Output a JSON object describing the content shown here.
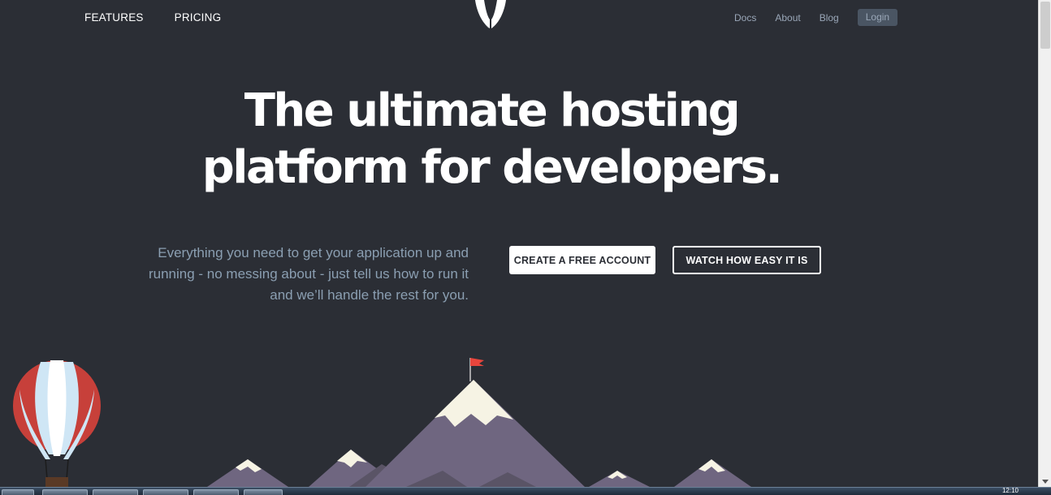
{
  "nav": {
    "left_items": [
      "FEATURES",
      "PRICING"
    ],
    "right_links": [
      "Docs",
      "About",
      "Blog"
    ],
    "login_label": "Login"
  },
  "hero": {
    "title_line1": "The ultimate hosting",
    "title_line2": "platform for developers.",
    "tagline": "Everything you need to get your application up and running - no messing about - just tell us how to run it and we’ll handle the rest for you.",
    "create_label": "CREATE A FREE ACCOUNT",
    "watch_label": "WATCH HOW EASY IT IS"
  },
  "colors": {
    "background": "#2b2e35",
    "tagline": "#8b9fb2",
    "mountain": "#6f6680",
    "snow": "#f6f3e4",
    "flag": "#e8453c",
    "balloon_red": "#c7403a",
    "balloon_blue": "#cfe6f5"
  },
  "taskbar": {
    "clock": "12:10"
  }
}
